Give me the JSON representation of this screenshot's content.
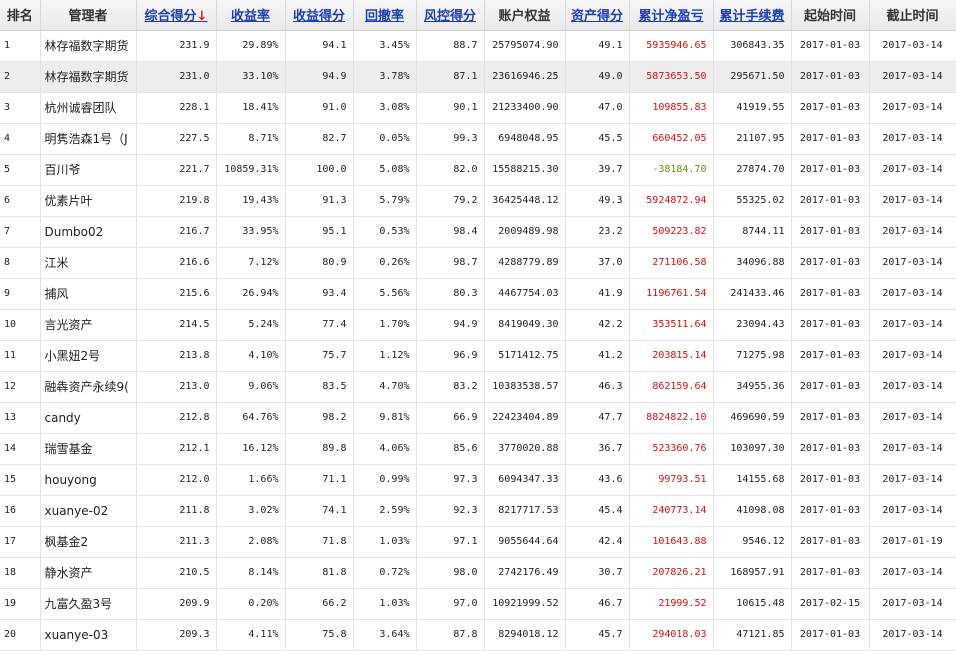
{
  "headers": [
    "排名",
    "管理者",
    "综合得分",
    "收益率",
    "收益得分",
    "回撤率",
    "风控得分",
    "账户权益",
    "资产得分",
    "累计净盈亏",
    "累计手续费",
    "起始时间",
    "截止时间"
  ],
  "sort_arrow": "↓",
  "colors": {
    "positive": "#d81010",
    "negative": "#6a8e12",
    "header_link": "#1f3fb0"
  },
  "rows": [
    {
      "rank": "1",
      "name": "林存福数字期货",
      "score": "231.9",
      "return_rate": "29.89%",
      "return_score": "94.1",
      "drawdown": "3.45%",
      "risk_score": "88.7",
      "equity": "25795074.90",
      "asset_score": "49.1",
      "net_pl": "5935946.65",
      "fees": "306843.35",
      "start": "2017-01-03",
      "end": "2017-03-14"
    },
    {
      "rank": "2",
      "name": "林存福数字期货",
      "score": "231.0",
      "return_rate": "33.10%",
      "return_score": "94.9",
      "drawdown": "3.78%",
      "risk_score": "87.1",
      "equity": "23616946.25",
      "asset_score": "49.0",
      "net_pl": "5873653.50",
      "fees": "295671.50",
      "start": "2017-01-03",
      "end": "2017-03-14"
    },
    {
      "rank": "3",
      "name": "杭州诚睿团队",
      "score": "228.1",
      "return_rate": "18.41%",
      "return_score": "91.0",
      "drawdown": "3.08%",
      "risk_score": "90.1",
      "equity": "21233400.90",
      "asset_score": "47.0",
      "net_pl": "109855.83",
      "fees": "41919.55",
      "start": "2017-01-03",
      "end": "2017-03-14"
    },
    {
      "rank": "4",
      "name": "明隽浩森1号（J",
      "score": "227.5",
      "return_rate": "8.71%",
      "return_score": "82.7",
      "drawdown": "0.05%",
      "risk_score": "99.3",
      "equity": "6948048.95",
      "asset_score": "45.5",
      "net_pl": "660452.05",
      "fees": "21107.95",
      "start": "2017-01-03",
      "end": "2017-03-14"
    },
    {
      "rank": "5",
      "name": "百川爷",
      "score": "221.7",
      "return_rate": "10859.31%",
      "return_score": "100.0",
      "drawdown": "5.08%",
      "risk_score": "82.0",
      "equity": "15588215.30",
      "asset_score": "39.7",
      "net_pl": "-38184.70",
      "fees": "27874.70",
      "start": "2017-01-03",
      "end": "2017-03-14"
    },
    {
      "rank": "6",
      "name": "优素片叶",
      "score": "219.8",
      "return_rate": "19.43%",
      "return_score": "91.3",
      "drawdown": "5.79%",
      "risk_score": "79.2",
      "equity": "36425448.12",
      "asset_score": "49.3",
      "net_pl": "5924872.94",
      "fees": "55325.02",
      "start": "2017-01-03",
      "end": "2017-03-14"
    },
    {
      "rank": "7",
      "name": "Dumbo02",
      "score": "216.7",
      "return_rate": "33.95%",
      "return_score": "95.1",
      "drawdown": "0.53%",
      "risk_score": "98.4",
      "equity": "2009489.98",
      "asset_score": "23.2",
      "net_pl": "509223.82",
      "fees": "8744.11",
      "start": "2017-01-03",
      "end": "2017-03-14"
    },
    {
      "rank": "8",
      "name": "江米",
      "score": "216.6",
      "return_rate": "7.12%",
      "return_score": "80.9",
      "drawdown": "0.26%",
      "risk_score": "98.7",
      "equity": "4288779.89",
      "asset_score": "37.0",
      "net_pl": "271106.58",
      "fees": "34096.88",
      "start": "2017-01-03",
      "end": "2017-03-14"
    },
    {
      "rank": "9",
      "name": "捕风",
      "score": "215.6",
      "return_rate": "26.94%",
      "return_score": "93.4",
      "drawdown": "5.56%",
      "risk_score": "80.3",
      "equity": "4467754.03",
      "asset_score": "41.9",
      "net_pl": "1196761.54",
      "fees": "241433.46",
      "start": "2017-01-03",
      "end": "2017-03-14"
    },
    {
      "rank": "10",
      "name": "言光资产",
      "score": "214.5",
      "return_rate": "5.24%",
      "return_score": "77.4",
      "drawdown": "1.70%",
      "risk_score": "94.9",
      "equity": "8419049.30",
      "asset_score": "42.2",
      "net_pl": "353511.64",
      "fees": "23094.43",
      "start": "2017-01-03",
      "end": "2017-03-14"
    },
    {
      "rank": "11",
      "name": "小黑妞2号",
      "score": "213.8",
      "return_rate": "4.10%",
      "return_score": "75.7",
      "drawdown": "1.12%",
      "risk_score": "96.9",
      "equity": "5171412.75",
      "asset_score": "41.2",
      "net_pl": "203815.14",
      "fees": "71275.98",
      "start": "2017-01-03",
      "end": "2017-03-14"
    },
    {
      "rank": "12",
      "name": "融犇资产永续9(",
      "score": "213.0",
      "return_rate": "9.06%",
      "return_score": "83.5",
      "drawdown": "4.70%",
      "risk_score": "83.2",
      "equity": "10383538.57",
      "asset_score": "46.3",
      "net_pl": "862159.64",
      "fees": "34955.36",
      "start": "2017-01-03",
      "end": "2017-03-14"
    },
    {
      "rank": "13",
      "name": "candy",
      "score": "212.8",
      "return_rate": "64.76%",
      "return_score": "98.2",
      "drawdown": "9.81%",
      "risk_score": "66.9",
      "equity": "22423404.89",
      "asset_score": "47.7",
      "net_pl": "8824822.10",
      "fees": "469690.59",
      "start": "2017-01-03",
      "end": "2017-03-14"
    },
    {
      "rank": "14",
      "name": "瑞雪基金",
      "score": "212.1",
      "return_rate": "16.12%",
      "return_score": "89.8",
      "drawdown": "4.06%",
      "risk_score": "85.6",
      "equity": "3770020.88",
      "asset_score": "36.7",
      "net_pl": "523360.76",
      "fees": "103097.30",
      "start": "2017-01-03",
      "end": "2017-03-14"
    },
    {
      "rank": "15",
      "name": "houyong",
      "score": "212.0",
      "return_rate": "1.66%",
      "return_score": "71.1",
      "drawdown": "0.99%",
      "risk_score": "97.3",
      "equity": "6094347.33",
      "asset_score": "43.6",
      "net_pl": "99793.51",
      "fees": "14155.68",
      "start": "2017-01-03",
      "end": "2017-03-14"
    },
    {
      "rank": "16",
      "name": "xuanye-02",
      "score": "211.8",
      "return_rate": "3.02%",
      "return_score": "74.1",
      "drawdown": "2.59%",
      "risk_score": "92.3",
      "equity": "8217717.53",
      "asset_score": "45.4",
      "net_pl": "240773.14",
      "fees": "41098.08",
      "start": "2017-01-03",
      "end": "2017-03-14"
    },
    {
      "rank": "17",
      "name": "枫基金2",
      "score": "211.3",
      "return_rate": "2.08%",
      "return_score": "71.8",
      "drawdown": "1.03%",
      "risk_score": "97.1",
      "equity": "9055644.64",
      "asset_score": "42.4",
      "net_pl": "101643.88",
      "fees": "9546.12",
      "start": "2017-01-03",
      "end": "2017-01-19"
    },
    {
      "rank": "18",
      "name": "静水资产",
      "score": "210.5",
      "return_rate": "8.14%",
      "return_score": "81.8",
      "drawdown": "0.72%",
      "risk_score": "98.0",
      "equity": "2742176.49",
      "asset_score": "30.7",
      "net_pl": "207826.21",
      "fees": "168957.91",
      "start": "2017-01-03",
      "end": "2017-03-14"
    },
    {
      "rank": "19",
      "name": "九富久盈3号",
      "score": "209.9",
      "return_rate": "0.20%",
      "return_score": "66.2",
      "drawdown": "1.03%",
      "risk_score": "97.0",
      "equity": "10921999.52",
      "asset_score": "46.7",
      "net_pl": "21999.52",
      "fees": "10615.48",
      "start": "2017-02-15",
      "end": "2017-03-14"
    },
    {
      "rank": "20",
      "name": "xuanye-03",
      "score": "209.3",
      "return_rate": "4.11%",
      "return_score": "75.8",
      "drawdown": "3.64%",
      "risk_score": "87.8",
      "equity": "8294018.12",
      "asset_score": "45.7",
      "net_pl": "294018.03",
      "fees": "47121.85",
      "start": "2017-01-03",
      "end": "2017-03-14"
    }
  ]
}
